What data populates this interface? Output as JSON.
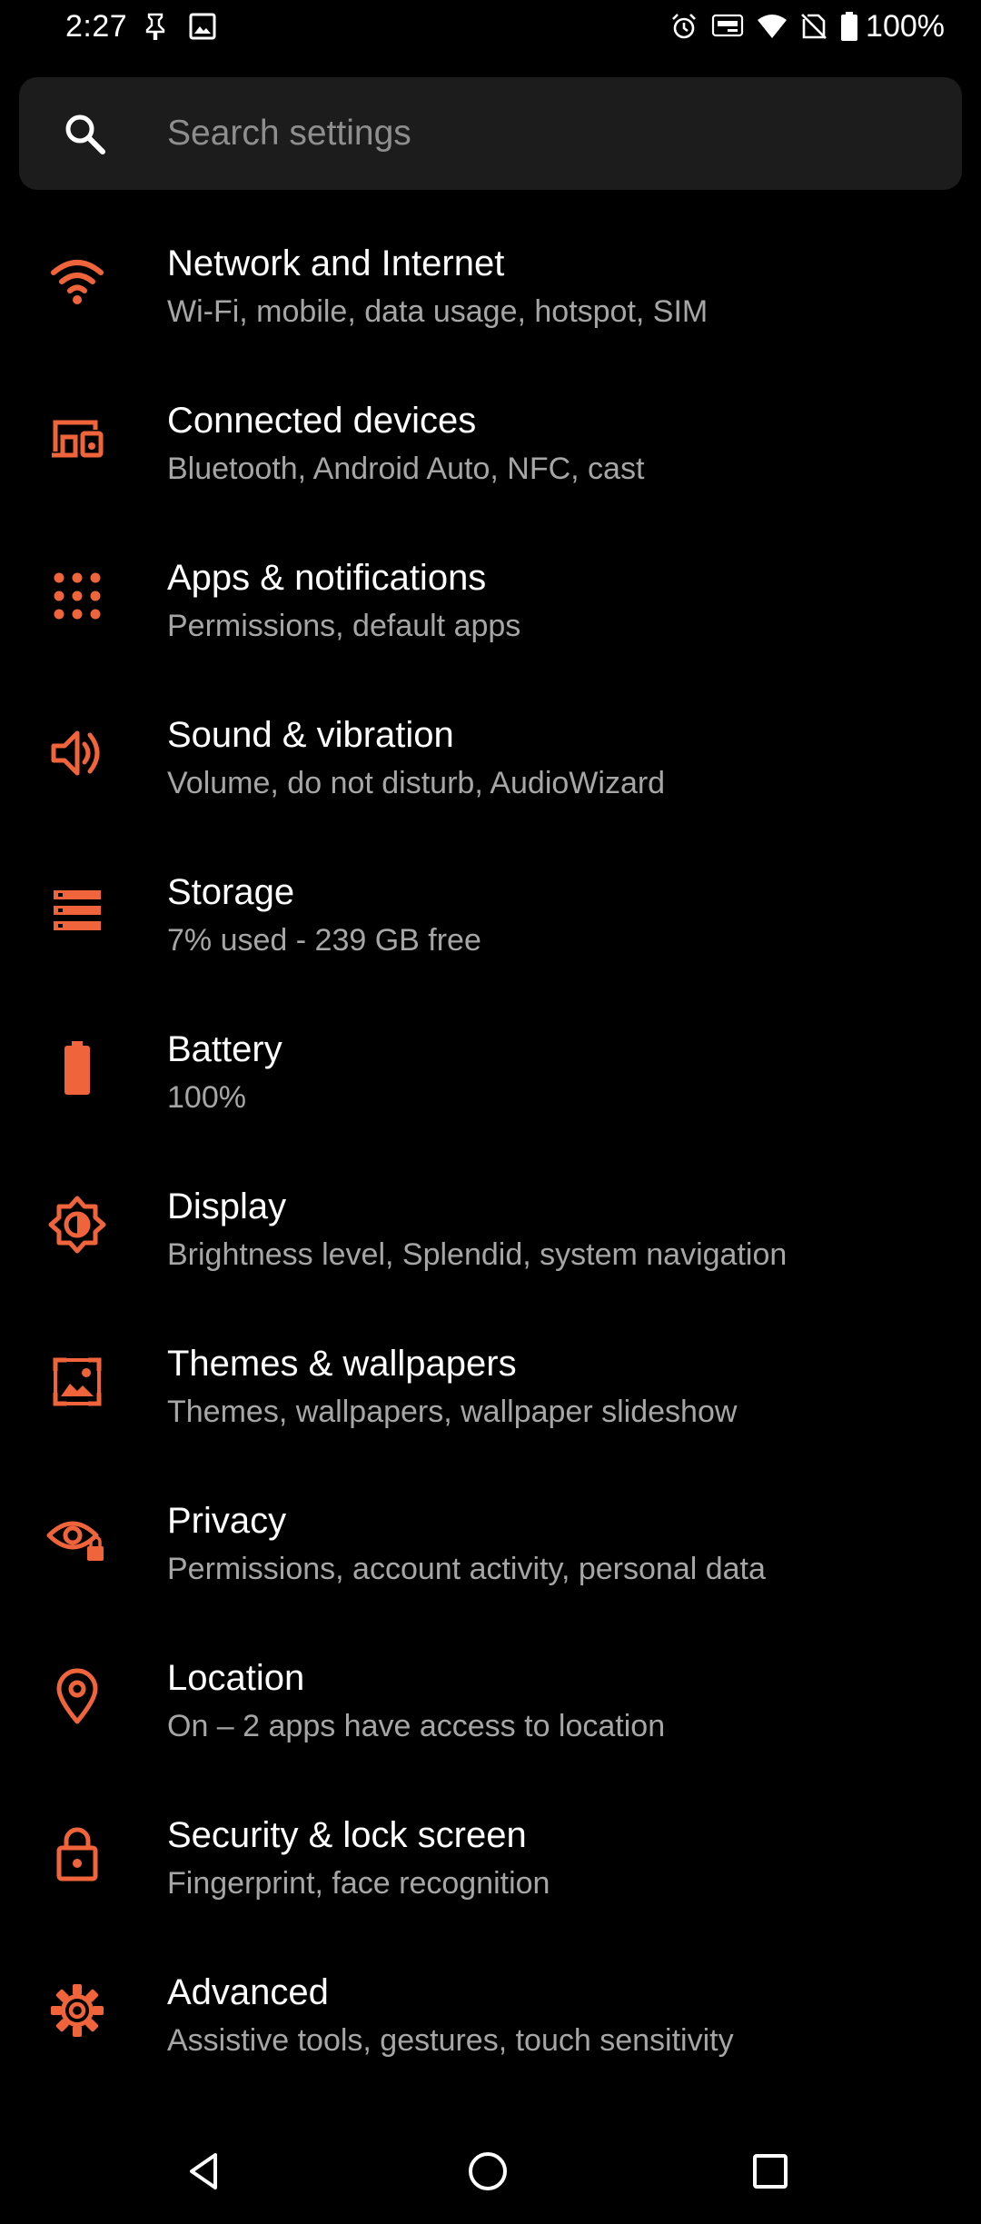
{
  "status_bar": {
    "time": "2:27",
    "battery_text": "100%",
    "left_icons": [
      "pin-icon",
      "image-icon"
    ],
    "right_icons": [
      "alarm-icon",
      "auto-hz-icon",
      "wifi-icon",
      "no-signal-icon",
      "battery-icon"
    ]
  },
  "search": {
    "placeholder": "Search settings"
  },
  "accent_color": "#f0643b",
  "settings": [
    {
      "title": "Network and Internet",
      "subtitle": "Wi-Fi, mobile, data usage, hotspot, SIM",
      "icon": "wifi-icon"
    },
    {
      "title": "Connected devices",
      "subtitle": "Bluetooth, Android Auto, NFC, cast",
      "icon": "devices-icon"
    },
    {
      "title": "Apps & notifications",
      "subtitle": "Permissions, default apps",
      "icon": "apps-grid-icon"
    },
    {
      "title": "Sound & vibration",
      "subtitle": "Volume, do not disturb, AudioWizard",
      "icon": "speaker-icon"
    },
    {
      "title": "Storage",
      "subtitle": "7% used - 239 GB free",
      "icon": "storage-icon"
    },
    {
      "title": "Battery",
      "subtitle": "100%",
      "icon": "battery-icon"
    },
    {
      "title": "Display",
      "subtitle": "Brightness level, Splendid, system navigation",
      "icon": "brightness-icon"
    },
    {
      "title": "Themes & wallpapers",
      "subtitle": "Themes, wallpapers, wallpaper slideshow",
      "icon": "wallpaper-icon"
    },
    {
      "title": "Privacy",
      "subtitle": "Permissions, account activity, personal data",
      "icon": "privacy-eye-icon"
    },
    {
      "title": "Location",
      "subtitle": "On – 2 apps have access to location",
      "icon": "location-pin-icon"
    },
    {
      "title": "Security & lock screen",
      "subtitle": "Fingerprint, face recognition",
      "icon": "lock-icon"
    },
    {
      "title": "Advanced",
      "subtitle": "Assistive tools, gestures, touch sensitivity",
      "icon": "gear-icon"
    }
  ],
  "nav_bar": {
    "buttons": [
      "back-icon",
      "home-icon",
      "recents-icon"
    ]
  }
}
